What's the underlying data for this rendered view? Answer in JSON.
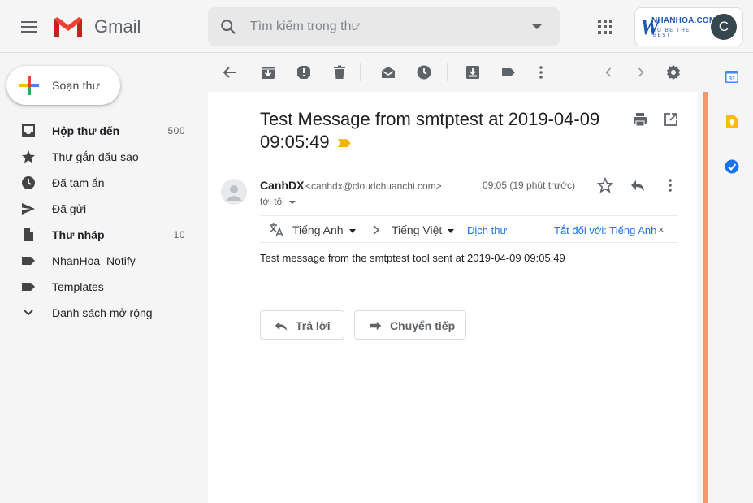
{
  "header": {
    "app_name": "Gmail",
    "search_placeholder": "Tìm kiếm trong thư",
    "account_brand": "NHANHOA.COM",
    "account_tagline": "TO BE THE BEST",
    "avatar_letter": "C"
  },
  "compose": {
    "label": "Soạn thư"
  },
  "nav": [
    {
      "label": "Hộp thư đến",
      "count": "500",
      "bold": true,
      "icon": "inbox-icon"
    },
    {
      "label": "Thư gắn dấu sao",
      "count": "",
      "bold": false,
      "icon": "star-icon"
    },
    {
      "label": "Đã tạm ẩn",
      "count": "",
      "bold": false,
      "icon": "clock-icon"
    },
    {
      "label": "Đã gửi",
      "count": "",
      "bold": false,
      "icon": "send-icon"
    },
    {
      "label": "Thư nháp",
      "count": "10",
      "bold": true,
      "icon": "draft-icon"
    },
    {
      "label": "NhanHoa_Notify",
      "count": "",
      "bold": false,
      "icon": "label-icon"
    },
    {
      "label": "Templates",
      "count": "",
      "bold": false,
      "icon": "label-icon"
    },
    {
      "label": "Danh sách mở rộng",
      "count": "",
      "bold": false,
      "icon": "chevron-down-icon"
    }
  ],
  "message": {
    "subject": "Test Message from smtptest at 2019-04-09 09:05:49",
    "sender_name": "CanhDX",
    "sender_email": "<canhdx@cloudchuanchi.com>",
    "to": "tới tôi",
    "time": "09:05 (19 phút trước)",
    "body": "Test message from the smtptest tool sent at 2019-04-09 09:05:49"
  },
  "translate": {
    "source_lang": "Tiếng Anh",
    "target_lang": "Tiếng Việt",
    "translate_link": "Dịch thư",
    "turn_off": "Tắt đối với: Tiếng Anh",
    "close": "×"
  },
  "actions": {
    "reply": "Trả lời",
    "forward": "Chuyển tiếp"
  },
  "side_panel": {
    "calendar_day": "31"
  },
  "colors": {
    "accent_blue": "#1a73e8",
    "important_marker": "#f4b400",
    "edge_orange": "#f09a6e"
  }
}
